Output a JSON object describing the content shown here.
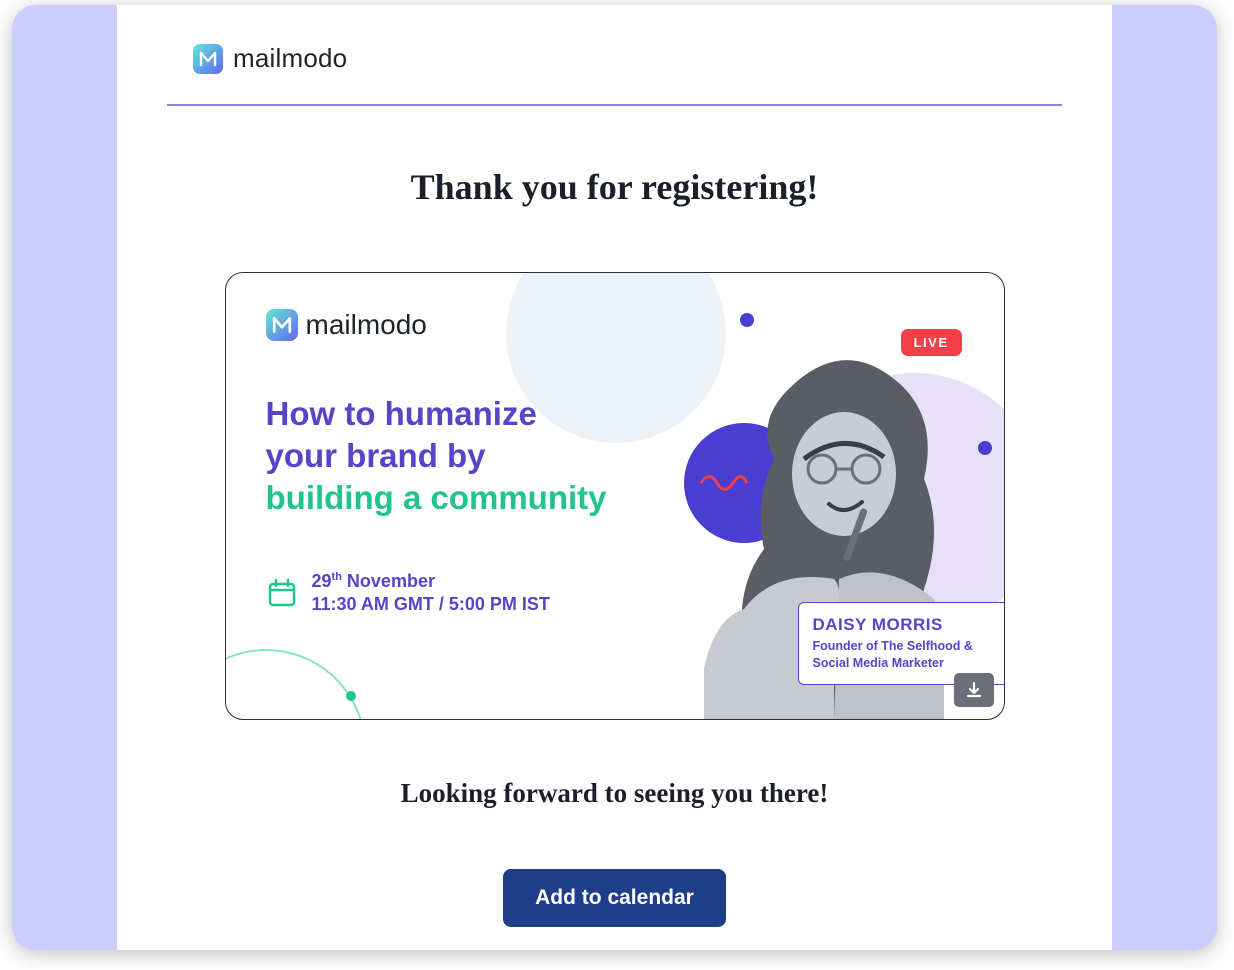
{
  "brand": {
    "name": "mailmodo"
  },
  "headline": "Thank you for registering!",
  "promo": {
    "brand": "mailmodo",
    "title_line1": "How to humanize",
    "title_line2": "your brand by",
    "title_line3": "building a community",
    "date_line1_prefix": "29",
    "date_line1_ord": "th",
    "date_line1_suffix": " November",
    "date_line2": "11:30 AM GMT / 5:00 PM IST",
    "live_label": "LIVE",
    "speaker_name": "DAISY MORRIS",
    "speaker_role": "Founder of The Selfhood & Social Media Marketer"
  },
  "sub_headline": "Looking forward to seeing you there!",
  "cta_label": "Add to calendar"
}
